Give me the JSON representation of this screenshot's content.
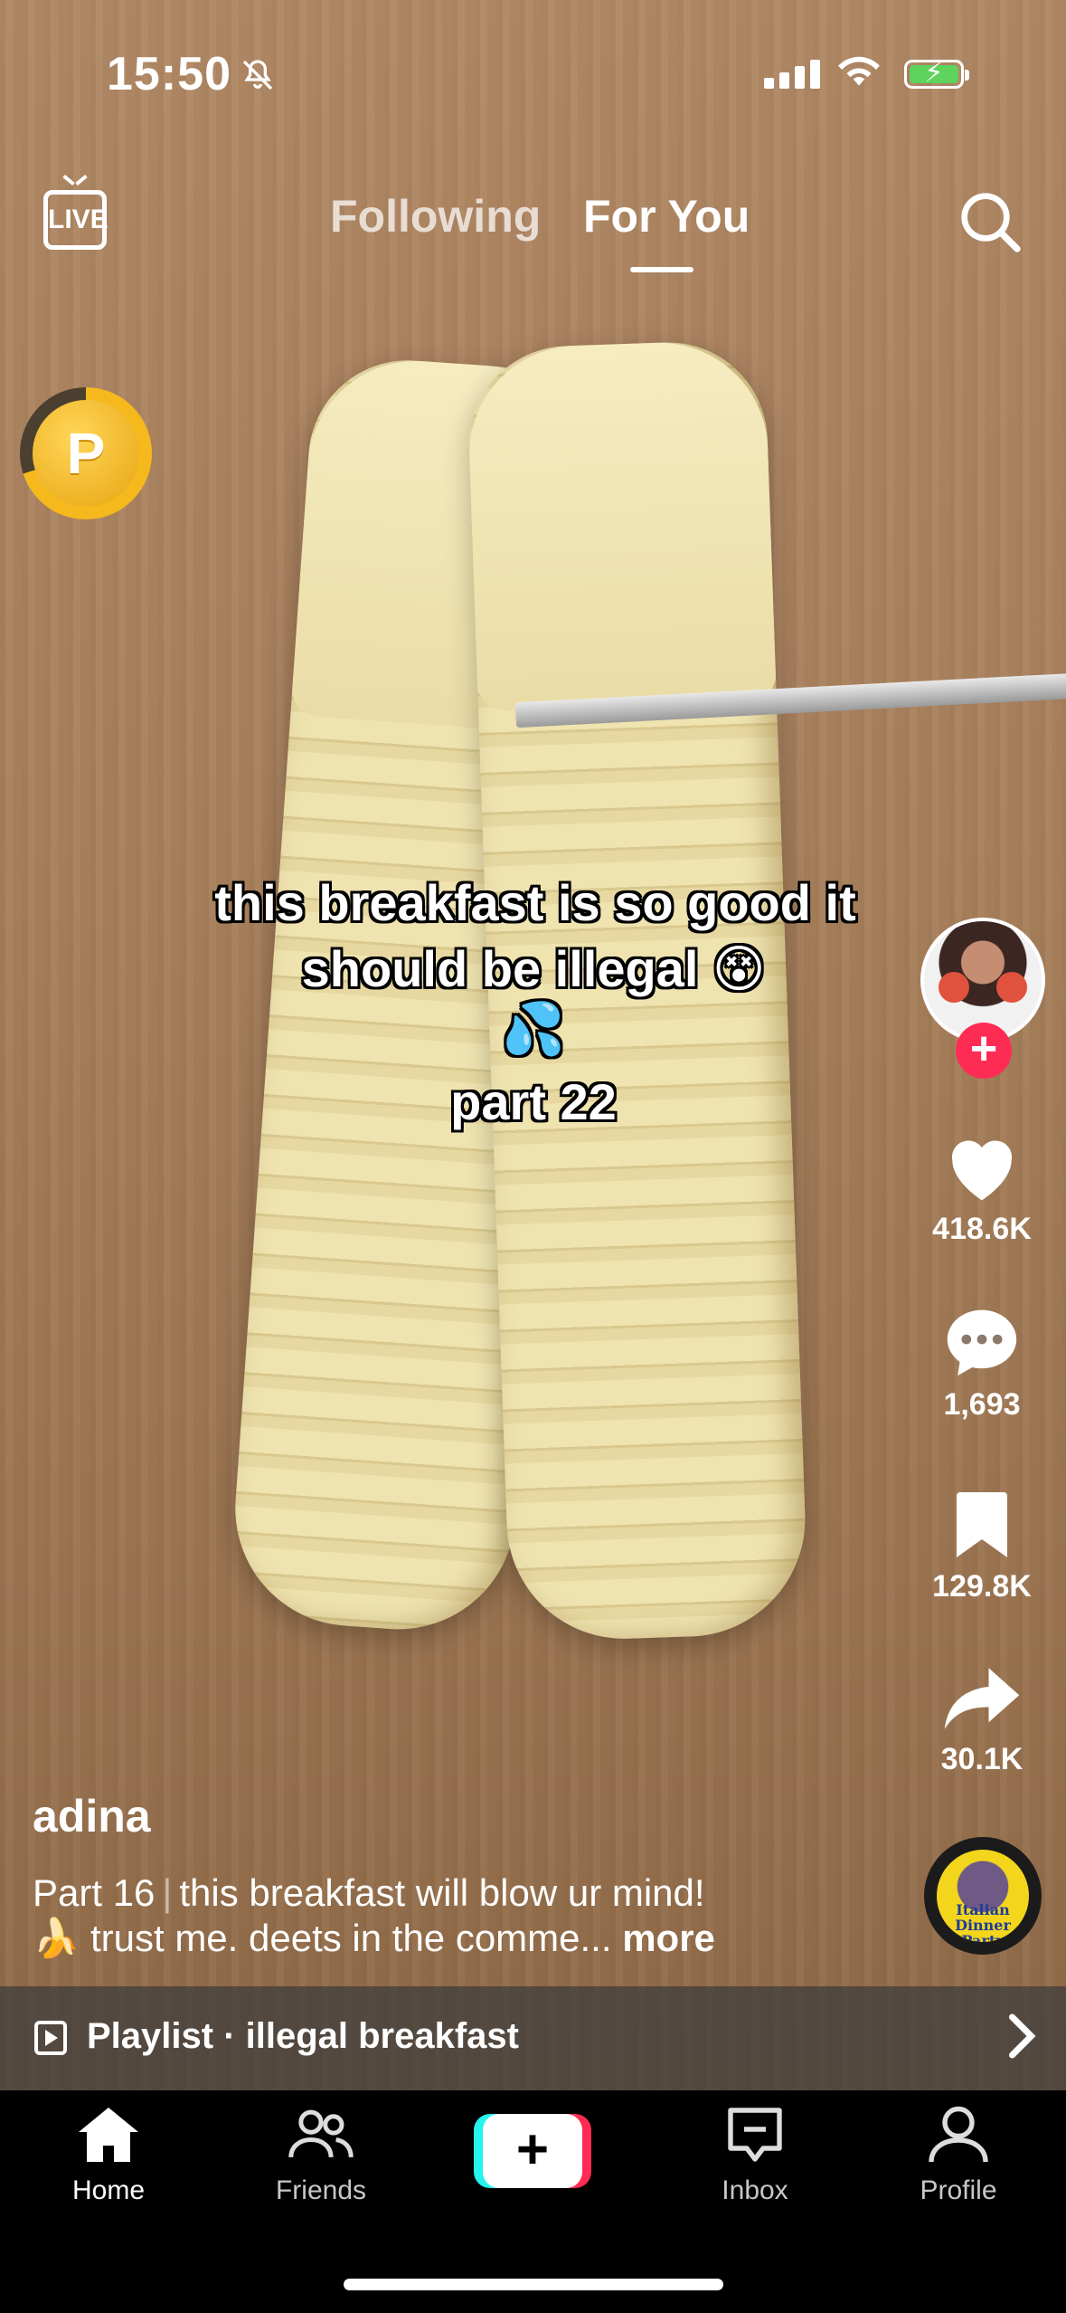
{
  "status_bar": {
    "time": "15:50",
    "mute_icon": "bell-slash-icon",
    "signal_icon": "cellular-signal-icon",
    "wifi_icon": "wifi-icon",
    "battery_icon": "battery-charging-icon",
    "battery_color": "#5ed35d"
  },
  "top_nav": {
    "live_label": "LIVE",
    "tabs": [
      {
        "label": "Following",
        "active": false
      },
      {
        "label": "For You",
        "active": true
      }
    ],
    "search_icon": "search-icon"
  },
  "coin_widget": {
    "label": "P",
    "progress_fraction": 0.7,
    "color": "#f5b81d"
  },
  "video": {
    "caption_lines": [
      "this breakfast is so good it",
      "should be illegal 😵💦"
    ],
    "part_label": "part 22"
  },
  "actions": {
    "likes": "418.6K",
    "comments": "1,693",
    "saves": "129.8K",
    "shares": "30.1K",
    "follow_plus": "+",
    "accent_color": "#fe2c55"
  },
  "music_disc": {
    "art_text": "Italian Dinner Party"
  },
  "post": {
    "username": "adina",
    "description_part": "Part 16",
    "description_title": "this breakfast will blow ur mind!",
    "description_line2": "🍌 trust me. deets in the comme...",
    "more_label": "more"
  },
  "playlist": {
    "label": "Playlist · illegal breakfast"
  },
  "bottom_nav": {
    "items": [
      {
        "label": "Home",
        "icon": "home-icon",
        "active": true
      },
      {
        "label": "Friends",
        "icon": "friends-icon",
        "active": false
      },
      {
        "label": "+",
        "icon": "create-icon",
        "active": false
      },
      {
        "label": "Inbox",
        "icon": "inbox-icon",
        "active": false
      },
      {
        "label": "Profile",
        "icon": "profile-icon",
        "active": false
      }
    ],
    "create_colors": [
      "#25f4ee",
      "#fe2c55"
    ]
  }
}
